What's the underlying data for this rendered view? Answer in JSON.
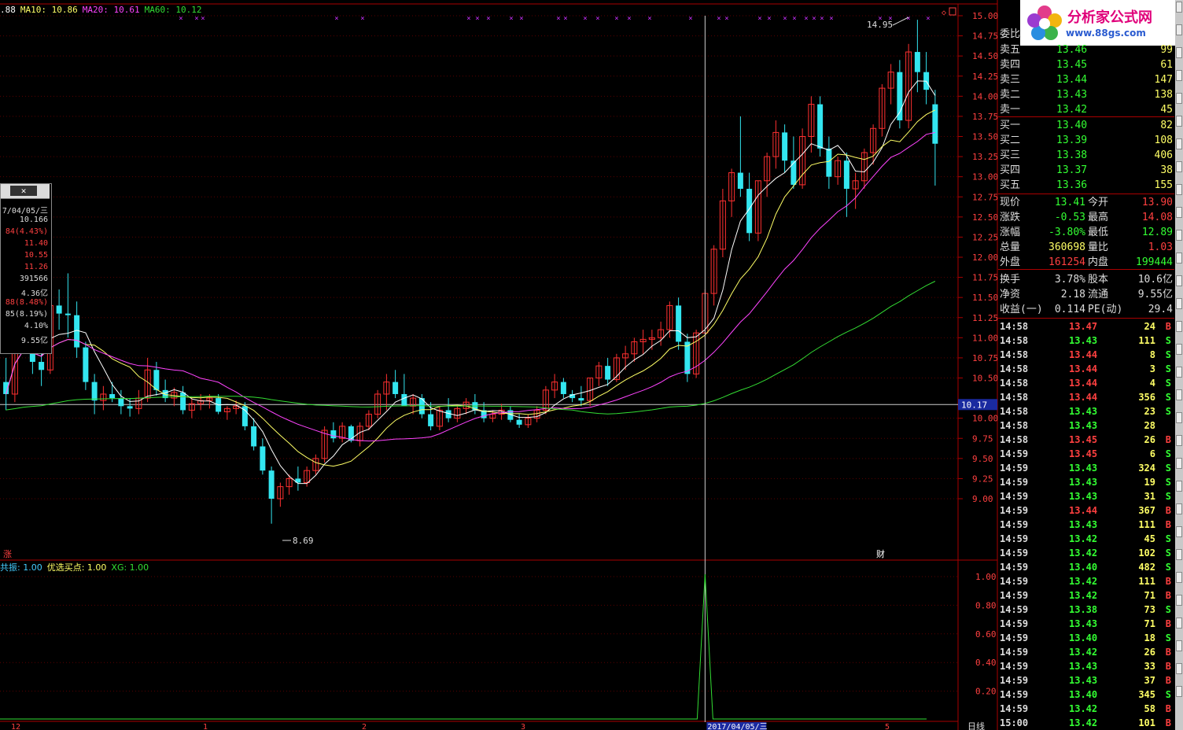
{
  "ma_legend": [
    {
      "label": ".88",
      "color": "#ffffff"
    },
    {
      "label": "MA10: 10.86",
      "color": "#ffff66"
    },
    {
      "label": "MA20: 10.61",
      "color": "#ff44ff"
    },
    {
      "label": "MA60: 10.12",
      "color": "#33dd33"
    }
  ],
  "indicator_legend": [
    {
      "label": "共振: 1.00",
      "color": "#44ccff"
    },
    {
      "label": "优选买点: 1.00",
      "color": "#ffff66"
    },
    {
      "label": "XG: 1.00",
      "color": "#33dd33"
    }
  ],
  "price_axis": [
    "15.00",
    "14.75",
    "14.50",
    "14.25",
    "14.00",
    "13.75",
    "13.50",
    "13.25",
    "13.00",
    "12.75",
    "12.50",
    "12.25",
    "12.00",
    "11.75",
    "11.50",
    "11.25",
    "11.00",
    "10.75",
    "10.50",
    "10.00",
    "9.75",
    "9.50",
    "9.25",
    "9.00"
  ],
  "current_line_label": "10.17",
  "ind_axis": [
    "1.00",
    "0.80",
    "0.60",
    "0.40",
    "0.20"
  ],
  "annotations": {
    "high": "14.95",
    "low": "8.69",
    "zhang": "涨",
    "cai": "财",
    "date_bottom": "2017/04/05/三",
    "riqi": "日线"
  },
  "date_ticks": [
    "12",
    "1",
    "2",
    "3",
    "5"
  ],
  "popup": {
    "close": "✕",
    "rows": [
      {
        "v": "7/04/05/三",
        "c": "#dddddd"
      },
      {
        "v": "10.166",
        "c": "#dddddd"
      },
      {
        "v": "84(4.43%)",
        "c": "#ff4040"
      },
      {
        "v": "11.40",
        "c": "#ff4040"
      },
      {
        "v": "10.55",
        "c": "#ff4040"
      },
      {
        "v": "11.26",
        "c": "#ff4040"
      },
      {
        "v": "391566",
        "c": "#dddddd"
      },
      {
        "v": "4.36亿",
        "c": "#dddddd"
      },
      {
        "v": "88(8.48%)",
        "c": "#ff4040"
      },
      {
        "v": "85(8.19%)",
        "c": "#dddddd"
      },
      {
        "v": "4.10%",
        "c": "#dddddd"
      },
      {
        "v": "9.55亿",
        "c": "#dddddd"
      }
    ]
  },
  "logo": {
    "title": "分析家公式网",
    "url": "www.88gs.com"
  },
  "quote": {
    "weibi": "委比",
    "sell": [
      {
        "l": "卖五",
        "p": "13.46",
        "v": "99"
      },
      {
        "l": "卖四",
        "p": "13.45",
        "v": "61"
      },
      {
        "l": "卖三",
        "p": "13.44",
        "v": "147"
      },
      {
        "l": "卖二",
        "p": "13.43",
        "v": "138"
      },
      {
        "l": "卖一",
        "p": "13.42",
        "v": "45"
      }
    ],
    "buy": [
      {
        "l": "买一",
        "p": "13.40",
        "v": "82"
      },
      {
        "l": "买二",
        "p": "13.39",
        "v": "108"
      },
      {
        "l": "买三",
        "p": "13.38",
        "v": "406"
      },
      {
        "l": "买四",
        "p": "13.37",
        "v": "38"
      },
      {
        "l": "买五",
        "p": "13.36",
        "v": "155"
      }
    ],
    "stats": [
      {
        "l1": "现价",
        "v1": "13.41",
        "c1": "#33ff33",
        "l2": "今开",
        "v2": "13.90",
        "c2": "#ff4040"
      },
      {
        "l1": "涨跌",
        "v1": "-0.53",
        "c1": "#33ff33",
        "l2": "最高",
        "v2": "14.08",
        "c2": "#ff4040"
      },
      {
        "l1": "涨幅",
        "v1": "-3.80%",
        "c1": "#33ff33",
        "l2": "最低",
        "v2": "12.89",
        "c2": "#33ff33"
      },
      {
        "l1": "总量",
        "v1": "360698",
        "c1": "#ffff66",
        "l2": "量比",
        "v2": "1.03",
        "c2": "#ff4040"
      },
      {
        "l1": "外盘",
        "v1": "161254",
        "c1": "#ff4040",
        "l2": "内盘",
        "v2": "199444",
        "c2": "#33ff33"
      },
      {
        "l1": "换手",
        "v1": "3.78%",
        "c1": "#dddddd",
        "l2": "股本",
        "v2": "10.6亿",
        "c2": "#dddddd"
      },
      {
        "l1": "净资",
        "v1": "2.18",
        "c1": "#dddddd",
        "l2": "流通",
        "v2": "9.55亿",
        "c2": "#dddddd"
      },
      {
        "l1": "收益(一)",
        "v1": "0.114",
        "c1": "#dddddd",
        "l2": "PE(动)",
        "v2": "29.4",
        "c2": "#dddddd"
      }
    ]
  },
  "ticks": [
    {
      "t": "14:58",
      "p": "13.47",
      "v": "24",
      "s": "B"
    },
    {
      "t": "14:58",
      "p": "13.43",
      "v": "111",
      "s": "S"
    },
    {
      "t": "14:58",
      "p": "13.44",
      "v": "8",
      "s": "S"
    },
    {
      "t": "14:58",
      "p": "13.44",
      "v": "3",
      "s": "S"
    },
    {
      "t": "14:58",
      "p": "13.44",
      "v": "4",
      "s": "S"
    },
    {
      "t": "14:58",
      "p": "13.44",
      "v": "356",
      "s": "S"
    },
    {
      "t": "14:58",
      "p": "13.43",
      "v": "23",
      "s": "S"
    },
    {
      "t": "14:58",
      "p": "13.43",
      "v": "28",
      "s": ""
    },
    {
      "t": "14:58",
      "p": "13.45",
      "v": "26",
      "s": "B"
    },
    {
      "t": "14:59",
      "p": "13.45",
      "v": "6",
      "s": "S"
    },
    {
      "t": "14:59",
      "p": "13.43",
      "v": "324",
      "s": "S"
    },
    {
      "t": "14:59",
      "p": "13.43",
      "v": "19",
      "s": "S"
    },
    {
      "t": "14:59",
      "p": "13.43",
      "v": "31",
      "s": "S"
    },
    {
      "t": "14:59",
      "p": "13.44",
      "v": "367",
      "s": "B"
    },
    {
      "t": "14:59",
      "p": "13.43",
      "v": "111",
      "s": "B"
    },
    {
      "t": "14:59",
      "p": "13.42",
      "v": "45",
      "s": "S"
    },
    {
      "t": "14:59",
      "p": "13.42",
      "v": "102",
      "s": "S"
    },
    {
      "t": "14:59",
      "p": "13.40",
      "v": "482",
      "s": "S"
    },
    {
      "t": "14:59",
      "p": "13.42",
      "v": "111",
      "s": "B"
    },
    {
      "t": "14:59",
      "p": "13.42",
      "v": "71",
      "s": "B"
    },
    {
      "t": "14:59",
      "p": "13.38",
      "v": "73",
      "s": "S"
    },
    {
      "t": "14:59",
      "p": "13.43",
      "v": "71",
      "s": "B"
    },
    {
      "t": "14:59",
      "p": "13.40",
      "v": "18",
      "s": "S"
    },
    {
      "t": "14:59",
      "p": "13.42",
      "v": "26",
      "s": "B"
    },
    {
      "t": "14:59",
      "p": "13.43",
      "v": "33",
      "s": "B"
    },
    {
      "t": "14:59",
      "p": "13.43",
      "v": "37",
      "s": "B"
    },
    {
      "t": "14:59",
      "p": "13.40",
      "v": "345",
      "s": "S"
    },
    {
      "t": "14:59",
      "p": "13.42",
      "v": "58",
      "s": "B"
    },
    {
      "t": "15:00",
      "p": "13.42",
      "v": "101",
      "s": "B"
    }
  ],
  "side_buttons": [
    "",
    "",
    "",
    "",
    "",
    "",
    "",
    "",
    "",
    "",
    "",
    "",
    "",
    "",
    "",
    "",
    "",
    "",
    "",
    "",
    "",
    "",
    "",
    "",
    "",
    "",
    "",
    "",
    "",
    "",
    ""
  ],
  "chart_data": {
    "type": "candlestick",
    "ylim": [
      8.5,
      15.0
    ],
    "candles": [
      [
        10.45,
        10.75,
        10.1,
        10.3
      ],
      [
        10.3,
        11.1,
        10.2,
        11.05
      ],
      [
        11.05,
        11.25,
        10.95,
        11.2
      ],
      [
        11.2,
        11.4,
        10.55,
        10.7
      ],
      [
        10.7,
        10.85,
        10.4,
        10.6
      ],
      [
        10.6,
        11.5,
        10.55,
        11.4
      ],
      [
        11.4,
        11.6,
        11.1,
        11.3
      ],
      [
        11.3,
        11.8,
        11.0,
        11.28
      ],
      [
        11.28,
        11.45,
        10.75,
        10.88
      ],
      [
        10.88,
        10.95,
        10.35,
        10.45
      ],
      [
        10.45,
        10.55,
        10.05,
        10.22
      ],
      [
        10.22,
        10.4,
        10.1,
        10.3
      ],
      [
        10.3,
        10.45,
        10.2,
        10.25
      ],
      [
        10.25,
        10.35,
        10.05,
        10.15
      ],
      [
        10.15,
        10.25,
        10.02,
        10.12
      ],
      [
        10.12,
        10.35,
        10.05,
        10.25
      ],
      [
        10.25,
        10.75,
        10.2,
        10.6
      ],
      [
        10.6,
        10.7,
        10.28,
        10.35
      ],
      [
        10.35,
        10.48,
        10.2,
        10.25
      ],
      [
        10.25,
        10.38,
        10.15,
        10.32
      ],
      [
        10.32,
        10.4,
        10.05,
        10.1
      ],
      [
        10.1,
        10.25,
        10.0,
        10.18
      ],
      [
        10.18,
        10.3,
        10.1,
        10.22
      ],
      [
        10.22,
        10.3,
        10.12,
        10.25
      ],
      [
        10.25,
        10.3,
        10.05,
        10.08
      ],
      [
        10.08,
        10.15,
        9.98,
        10.12
      ],
      [
        10.12,
        10.22,
        10.05,
        10.15
      ],
      [
        10.15,
        10.2,
        9.85,
        9.9
      ],
      [
        9.9,
        10.0,
        9.6,
        9.65
      ],
      [
        9.65,
        9.75,
        9.3,
        9.35
      ],
      [
        9.35,
        9.4,
        8.69,
        9.0
      ],
      [
        9.0,
        9.2,
        8.9,
        9.15
      ],
      [
        9.15,
        9.3,
        9.05,
        9.25
      ],
      [
        9.25,
        9.4,
        9.1,
        9.2
      ],
      [
        9.2,
        9.4,
        9.15,
        9.35
      ],
      [
        9.35,
        9.55,
        9.3,
        9.5
      ],
      [
        9.5,
        9.9,
        9.45,
        9.85
      ],
      [
        9.85,
        9.95,
        9.7,
        9.75
      ],
      [
        9.75,
        9.95,
        9.7,
        9.9
      ],
      [
        9.9,
        9.92,
        9.7,
        9.72
      ],
      [
        9.72,
        9.95,
        9.65,
        9.9
      ],
      [
        9.9,
        10.1,
        9.85,
        10.05
      ],
      [
        10.05,
        10.35,
        10.0,
        10.3
      ],
      [
        10.3,
        10.55,
        10.1,
        10.45
      ],
      [
        10.45,
        10.6,
        10.25,
        10.3
      ],
      [
        10.3,
        10.55,
        10.15,
        10.15
      ],
      [
        10.15,
        10.3,
        10.05,
        10.25
      ],
      [
        10.25,
        10.3,
        10.0,
        10.05
      ],
      [
        10.05,
        10.2,
        9.85,
        9.9
      ],
      [
        9.9,
        10.15,
        9.85,
        10.1
      ],
      [
        10.1,
        10.25,
        9.95,
        10.0
      ],
      [
        10.0,
        10.15,
        9.95,
        10.12
      ],
      [
        10.12,
        10.25,
        10.05,
        10.2
      ],
      [
        10.2,
        10.3,
        10.05,
        10.1
      ],
      [
        10.1,
        10.2,
        9.95,
        10.0
      ],
      [
        10.0,
        10.1,
        9.95,
        10.05
      ],
      [
        10.05,
        10.18,
        9.98,
        10.1
      ],
      [
        10.1,
        10.15,
        9.95,
        9.98
      ],
      [
        9.98,
        10.05,
        9.88,
        9.92
      ],
      [
        9.92,
        10.05,
        9.88,
        10.0
      ],
      [
        10.0,
        10.15,
        9.95,
        10.1
      ],
      [
        10.1,
        10.4,
        10.05,
        10.35
      ],
      [
        10.35,
        10.55,
        10.25,
        10.45
      ],
      [
        10.45,
        10.5,
        10.25,
        10.3
      ],
      [
        10.3,
        10.35,
        10.2,
        10.25
      ],
      [
        10.25,
        10.4,
        10.15,
        10.22
      ],
      [
        10.22,
        10.5,
        10.15,
        10.5
      ],
      [
        10.5,
        10.7,
        10.4,
        10.65
      ],
      [
        10.65,
        10.75,
        10.4,
        10.48
      ],
      [
        10.48,
        10.8,
        10.45,
        10.75
      ],
      [
        10.75,
        10.9,
        10.6,
        10.8
      ],
      [
        10.8,
        11.0,
        10.7,
        10.95
      ],
      [
        10.95,
        11.1,
        10.8,
        10.98
      ],
      [
        10.98,
        11.1,
        10.85,
        11.0
      ],
      [
        11.0,
        11.2,
        10.9,
        11.1
      ],
      [
        11.1,
        11.45,
        11.0,
        11.4
      ],
      [
        11.4,
        11.5,
        10.85,
        10.95
      ],
      [
        10.95,
        11.05,
        10.45,
        10.55
      ],
      [
        10.55,
        11.1,
        10.5,
        11.06
      ],
      [
        11.06,
        11.6,
        11.0,
        11.55
      ],
      [
        11.55,
        12.15,
        11.4,
        12.1
      ],
      [
        12.1,
        12.85,
        12.0,
        12.7
      ],
      [
        12.7,
        13.1,
        12.5,
        13.05
      ],
      [
        13.05,
        13.75,
        12.75,
        12.85
      ],
      [
        12.85,
        13.05,
        12.2,
        12.3
      ],
      [
        12.3,
        12.95,
        12.2,
        12.95
      ],
      [
        12.95,
        13.3,
        12.75,
        13.25
      ],
      [
        13.25,
        13.7,
        13.1,
        13.55
      ],
      [
        13.55,
        13.65,
        13.05,
        13.2
      ],
      [
        13.2,
        13.5,
        12.85,
        12.9
      ],
      [
        12.9,
        13.6,
        12.85,
        13.5
      ],
      [
        13.5,
        14.0,
        13.3,
        13.9
      ],
      [
        13.9,
        14.0,
        13.25,
        13.35
      ],
      [
        13.35,
        13.5,
        12.85,
        13.0
      ],
      [
        13.0,
        13.25,
        12.9,
        13.2
      ],
      [
        13.2,
        13.3,
        12.5,
        12.85
      ],
      [
        12.85,
        13.05,
        12.6,
        12.95
      ],
      [
        12.95,
        13.35,
        12.85,
        13.3
      ],
      [
        13.3,
        13.65,
        13.15,
        13.6
      ],
      [
        13.6,
        14.15,
        13.5,
        14.1
      ],
      [
        14.1,
        14.4,
        13.9,
        14.3
      ],
      [
        14.3,
        14.45,
        13.6,
        13.7
      ],
      [
        13.7,
        14.65,
        13.6,
        14.55
      ],
      [
        14.55,
        14.95,
        14.05,
        14.3
      ],
      [
        14.3,
        14.55,
        13.9,
        14.08
      ],
      [
        13.9,
        14.08,
        12.89,
        13.41
      ]
    ],
    "signal_spike_index": 79
  }
}
